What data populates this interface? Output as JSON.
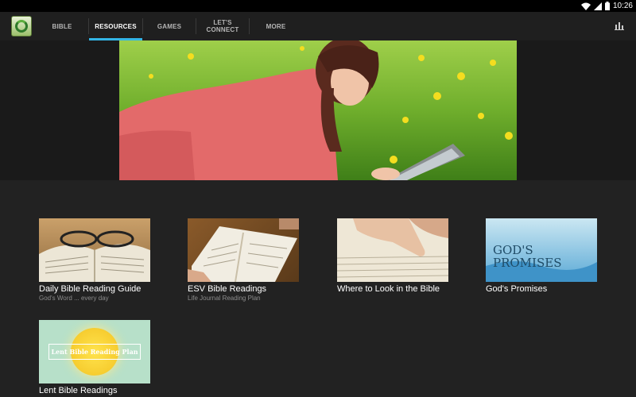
{
  "status_bar": {
    "time": "10:26",
    "icons": [
      "wifi-icon",
      "signal-icon",
      "battery-icon"
    ]
  },
  "app": {
    "logo_icon": "bible-app-logo-icon",
    "accent_color": "#33b5e5"
  },
  "tabs": [
    {
      "label": "BIBLE",
      "active": false
    },
    {
      "label": "RESOURCES",
      "active": true
    },
    {
      "label": "GAMES",
      "active": false
    },
    {
      "label": "LET'S\nCONNECT",
      "active": false
    },
    {
      "label": "MORE",
      "active": false
    }
  ],
  "actionbar": {
    "right_icon": "bar-chart-icon"
  },
  "resources": [
    {
      "title": "Daily Bible Reading Guide",
      "subtitle": "God's Word ... every day"
    },
    {
      "title": "ESV Bible Readings",
      "subtitle": "Life Journal Reading Plan"
    },
    {
      "title": "Where to Look in the Bible",
      "subtitle": ""
    },
    {
      "title": "God's Promises",
      "subtitle": "",
      "thumb_text": "GOD'S\nPROMISES"
    },
    {
      "title": "Lent Bible Readings",
      "subtitle": "",
      "thumb_text": "Lent Bible Reading Plan"
    }
  ]
}
